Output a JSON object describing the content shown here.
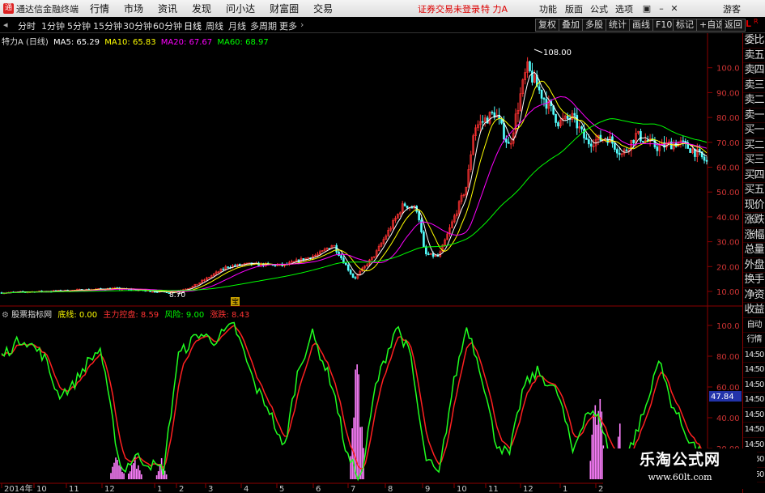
{
  "titlebar": {
    "app_title": "通达信金融终端",
    "menus": [
      "行情",
      "市场",
      "资讯",
      "发现",
      "问小达",
      "财富圈",
      "交易"
    ],
    "login_status": "证券交易未登录",
    "stock_name": "特 力A",
    "right_menus": [
      "功能",
      "版面",
      "公式",
      "选项"
    ],
    "guest": "游客"
  },
  "periods": [
    "分时",
    "1分钟",
    "5分钟",
    "15分钟",
    "30分钟",
    "60分钟",
    "日线",
    "周线",
    "月线",
    "多周期",
    "更多"
  ],
  "toolbar": [
    "复权",
    "叠加",
    "多股",
    "统计",
    "画线",
    "F10",
    "标记",
    "+自选",
    "返回"
  ],
  "main_legend": {
    "title": "特力A (日线)",
    "ma5": "MA5: 65.29",
    "ma10": "MA10: 65.83",
    "ma20": "MA20: 67.67",
    "ma60": "MA60: 68.97"
  },
  "sub_legend": {
    "title": "股票指标网",
    "s1": "底线: 0.00",
    "s2": "主力控盘: 8.59",
    "s3": "风险: 9.00",
    "s4": "涨跌: 8.43"
  },
  "annotations": {
    "high": "108.00",
    "low": "8.70",
    "marker": "宝"
  },
  "price_axis": [
    "100.0",
    "90.00",
    "80.00",
    "70.00",
    "60.00",
    "50.00",
    "40.00",
    "30.00",
    "20.00",
    "10.00"
  ],
  "sub_axis": [
    "100.0",
    "80.00",
    "60.00",
    "40.00",
    "20.00"
  ],
  "sub_axis_current": "47.84",
  "time_axis": [
    "2014年",
    "10",
    "11",
    "12",
    "1",
    "2",
    "3",
    "4",
    "5",
    "6",
    "7",
    "8",
    "9",
    "10",
    "11",
    "12",
    "1",
    "2"
  ],
  "right_panel": [
    "委比",
    "卖五",
    "卖四",
    "卖三",
    "卖二",
    "卖一",
    "买一",
    "买二",
    "买三",
    "买四",
    "买五",
    "现价",
    "涨跌",
    "涨幅",
    "总量",
    "外盘",
    "换手",
    "净资",
    "收益",
    "自动",
    "行情",
    "14:50",
    "14:50",
    "14:50",
    "14:50",
    "14:50",
    "14:50",
    "14:50",
    "14:50",
    "14:50"
  ],
  "watermark": {
    "line1": "乐淘公式网",
    "line2": "www.60lt.com"
  },
  "colors": {
    "ma5": "#ffffff",
    "ma10": "#ffff00",
    "ma20": "#ff00ff",
    "ma60": "#00ff00",
    "up": "#ff3232",
    "down": "#54ffff",
    "red_line": "#ff2020",
    "green_line": "#20ff20",
    "bars": "#ff80ff"
  },
  "icons": {
    "close": "close-icon",
    "minimize": "minimize-icon",
    "maximize": "maximize-icon"
  }
}
